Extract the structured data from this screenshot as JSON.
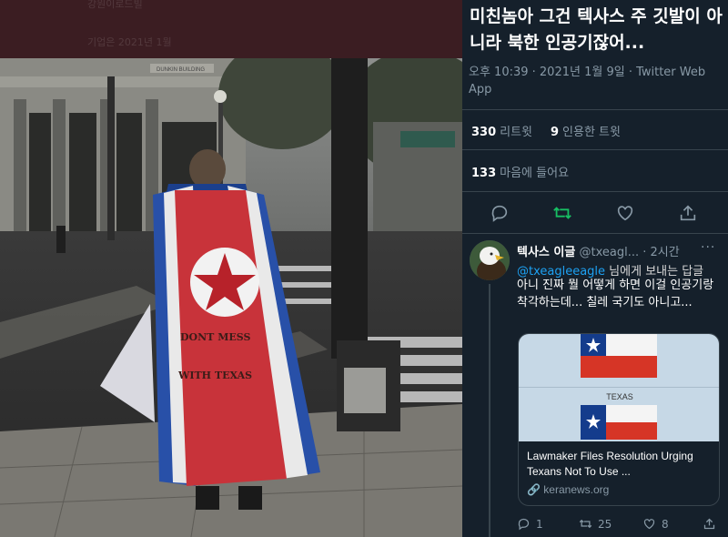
{
  "photo": {
    "faded_line_1": "강원이로드빌",
    "faded_line_2": "기업은 2021년 1월",
    "banner_text": "DUNKIN BUILDING",
    "flag_line_1": "DONT   MESS",
    "flag_line_2": "WITH   TEXAS"
  },
  "tweet": {
    "text": "미친놈아 그건 텍사스 주 깃발이 아니라 북한 인공기잖어...",
    "meta": "오후 10:39 · 2021년 1월 9일 · Twitter Web App",
    "retweets_count": "330",
    "retweets_label": "리트윗",
    "quotes_count": "9",
    "quotes_label": "인용한 트윗",
    "likes_count": "133",
    "likes_label": "마음에 들어요",
    "actions": [
      "reply-icon",
      "retweet-icon",
      "like-icon",
      "share-icon"
    ]
  },
  "reply": {
    "name": "텍사스 이글",
    "handle": "@txeagl...",
    "time": "· 2시간",
    "more": "···",
    "replying_to_handle": "@txeagleeagle",
    "replying_to_suffix": " 님에게 보내는 답글",
    "body": "아니 진짜 뭘 어떻게 하면 이걸 인공기랑 착각하는데... 칠레 국기도 아니고...",
    "card": {
      "image_label": "TEXAS",
      "title": "Lawmaker Files Resolution Urging Texans Not To Use ...",
      "domain": "keranews.org"
    },
    "reply_count": "1",
    "retweet_count": "25",
    "like_count": "8"
  },
  "colors": {
    "accent": "#1da1f2",
    "retweet_green": "#17bf63",
    "panel_bg": "#15202b",
    "secondary_text": "#8899a6"
  }
}
